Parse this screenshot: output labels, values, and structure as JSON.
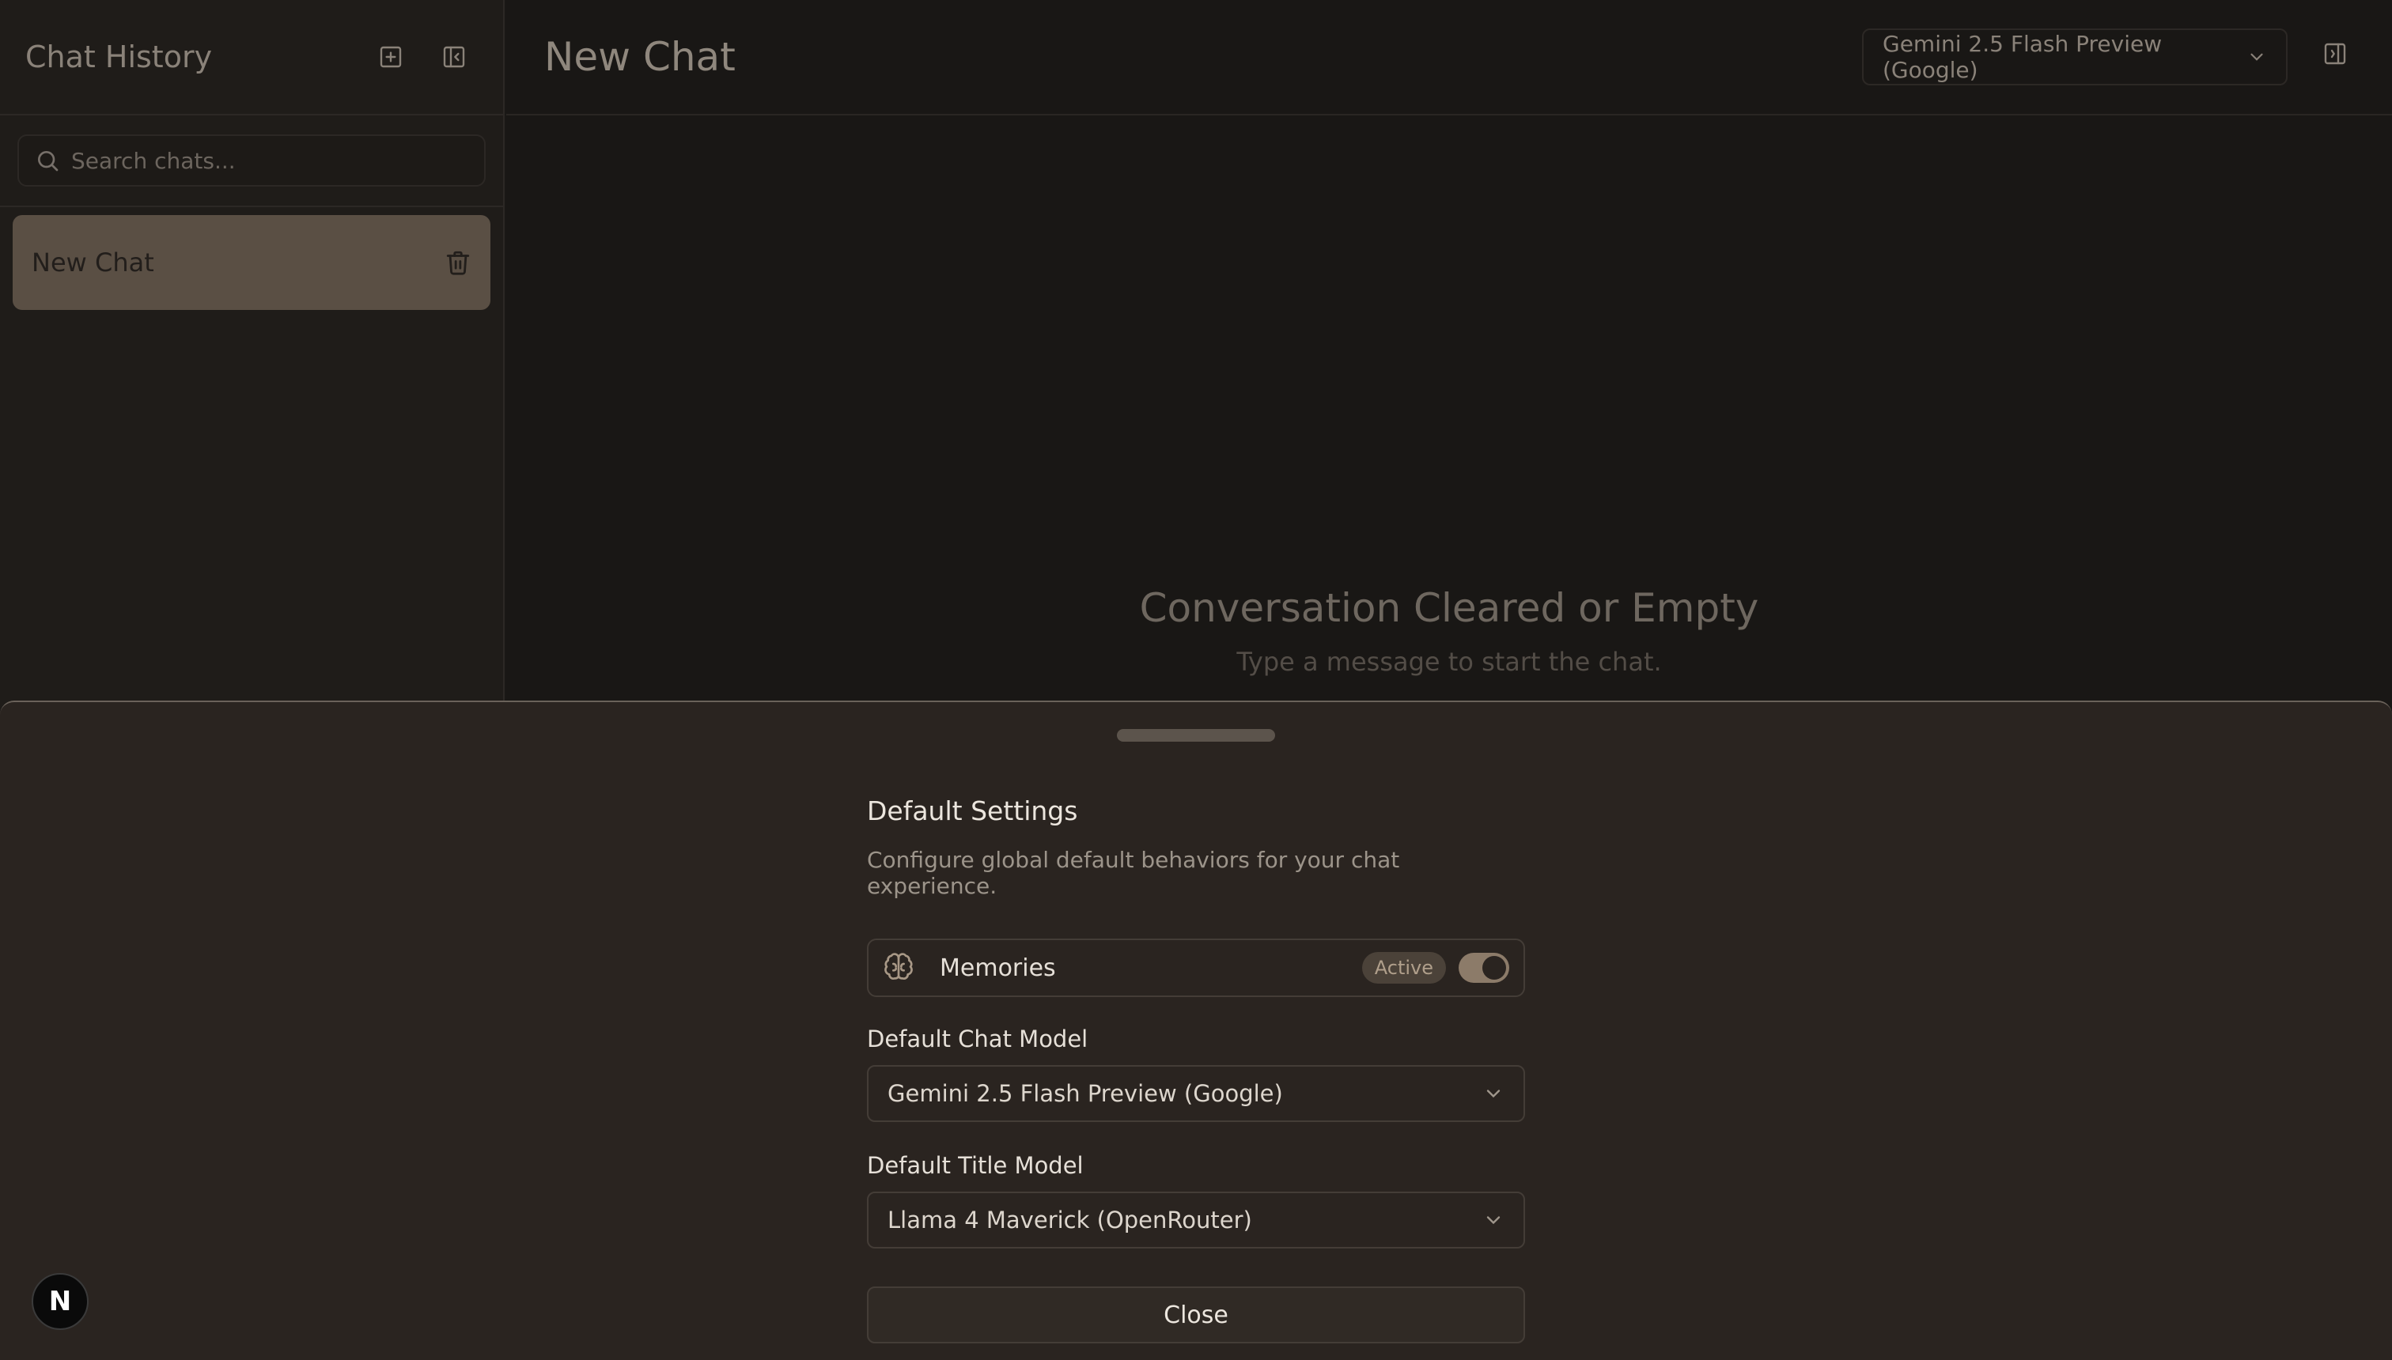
{
  "sidebar": {
    "title": "Chat History",
    "search_placeholder": "Search chats...",
    "chats": [
      {
        "label": "New Chat"
      }
    ]
  },
  "main": {
    "title": "New Chat",
    "model_selector": "Gemini 2.5 Flash Preview (Google)",
    "empty_title": "Conversation Cleared or Empty",
    "empty_subtitle": "Type a message to start the chat."
  },
  "settings": {
    "title": "Default Settings",
    "description": "Configure global default behaviors for your chat experience.",
    "memories": {
      "label": "Memories",
      "status": "Active",
      "enabled": true
    },
    "chat_model": {
      "label": "Default Chat Model",
      "value": "Gemini 2.5 Flash Preview (Google)"
    },
    "title_model": {
      "label": "Default Title Model",
      "value": "Llama 4 Maverick (OpenRouter)"
    },
    "close_label": "Close"
  },
  "badge": {
    "letter": "N"
  },
  "colors": {
    "accent": "#8c7b69",
    "sheet_bg": "#2a2420",
    "chat_item_bg": "#5a4f44"
  }
}
